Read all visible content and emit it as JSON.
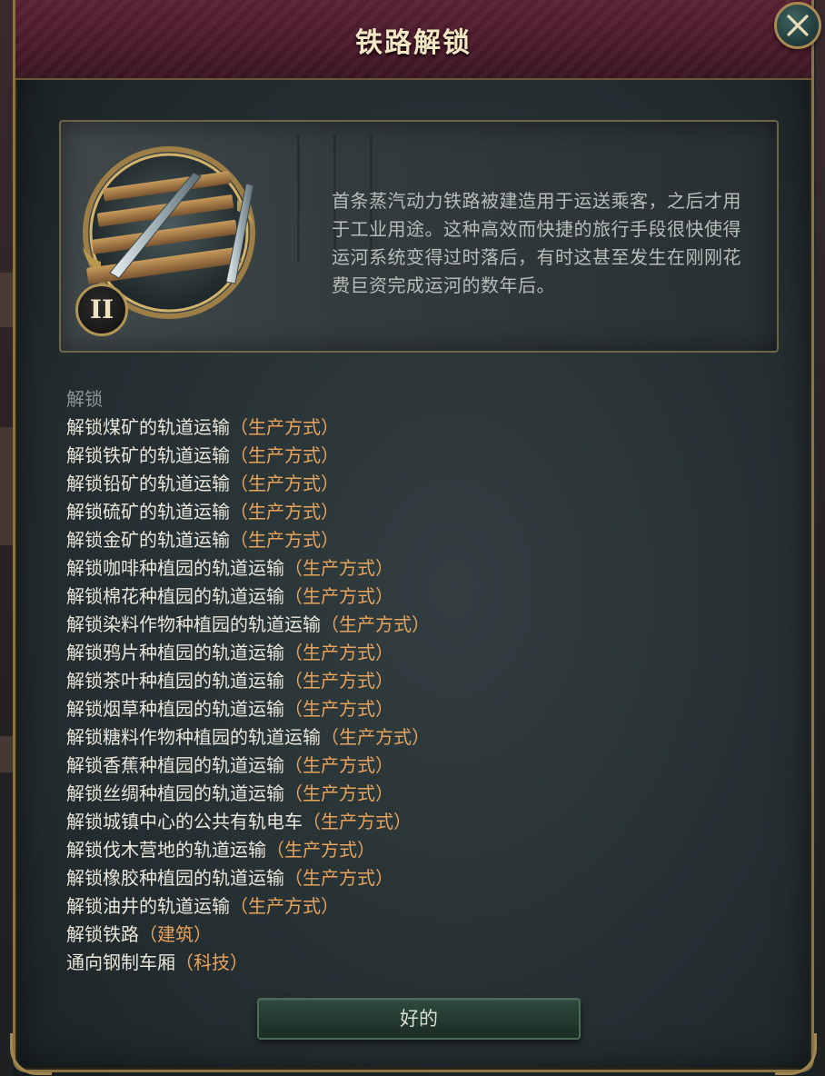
{
  "dialog": {
    "title": "铁路解锁",
    "close_icon": "close-icon"
  },
  "tech": {
    "tier": "II",
    "icon": "railway-track-icon",
    "description": "首条蒸汽动力铁路被建造用于运送乘客，之后才用于工业用途。这种高效而快捷的旅行手段很快使得运河系统变得过时落后，有时这甚至发生在刚刚花费巨资完成运河的数年后。"
  },
  "unlocks": {
    "heading": "解锁",
    "items": [
      {
        "text": "解锁煤矿的轨道运输",
        "tag": "（生产方式）"
      },
      {
        "text": "解锁铁矿的轨道运输",
        "tag": "（生产方式）"
      },
      {
        "text": "解锁铅矿的轨道运输",
        "tag": "（生产方式）"
      },
      {
        "text": "解锁硫矿的轨道运输",
        "tag": "（生产方式）"
      },
      {
        "text": "解锁金矿的轨道运输",
        "tag": "（生产方式）"
      },
      {
        "text": "解锁咖啡种植园的轨道运输",
        "tag": "（生产方式）"
      },
      {
        "text": "解锁棉花种植园的轨道运输",
        "tag": "（生产方式）"
      },
      {
        "text": "解锁染料作物种植园的轨道运输",
        "tag": "（生产方式）"
      },
      {
        "text": "解锁鸦片种植园的轨道运输",
        "tag": "（生产方式）"
      },
      {
        "text": "解锁茶叶种植园的轨道运输",
        "tag": "（生产方式）"
      },
      {
        "text": "解锁烟草种植园的轨道运输",
        "tag": "（生产方式）"
      },
      {
        "text": "解锁糖料作物种植园的轨道运输",
        "tag": "（生产方式）"
      },
      {
        "text": "解锁香蕉种植园的轨道运输",
        "tag": "（生产方式）"
      },
      {
        "text": "解锁丝绸种植园的轨道运输",
        "tag": "（生产方式）"
      },
      {
        "text": "解锁城镇中心的公共有轨电车",
        "tag": "（生产方式）"
      },
      {
        "text": "解锁伐木营地的轨道运输",
        "tag": "（生产方式）"
      },
      {
        "text": "解锁橡胶种植园的轨道运输",
        "tag": "（生产方式）"
      },
      {
        "text": "解锁油井的轨道运输",
        "tag": "（生产方式）"
      },
      {
        "text": "解锁铁路",
        "tag": "（建筑）"
      },
      {
        "text": "通向钢制车厢",
        "tag": "（科技）"
      }
    ]
  },
  "footer": {
    "ok_label": "好的"
  },
  "colors": {
    "title": "#f3e6c4",
    "header_bg": "#4a1a2a",
    "frame_gold": "#8a7346",
    "tag_orange": "#e8a35d",
    "body_text": "#e9e6da",
    "button_green": "#23392f"
  }
}
